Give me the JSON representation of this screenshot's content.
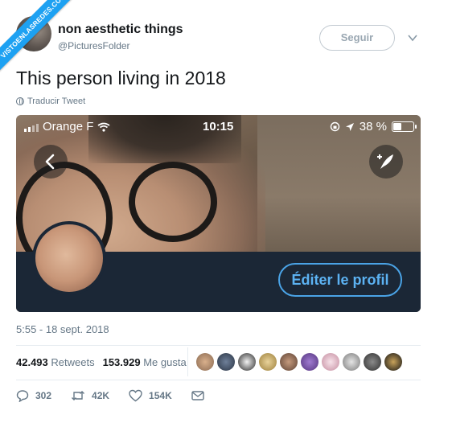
{
  "watermark": {
    "text": "VISTOENLASREDES.COM"
  },
  "author": {
    "display_name": "non aesthetic things",
    "handle": "@PicturesFolder"
  },
  "follow_button": {
    "label": "Seguir"
  },
  "tweet": {
    "text": "This person living in 2018",
    "translate_label": "Traducir Tweet",
    "timestamp": "5:55 - 18 sept. 2018"
  },
  "media": {
    "status_bar": {
      "carrier": "Orange F",
      "time": "10:15",
      "battery": "38 %",
      "battery_level": 0.38
    },
    "edit_profile_label": "Éditer le profil"
  },
  "stats": {
    "retweets_count": "42.493",
    "retweets_label": "Retweets",
    "likes_count": "153.929",
    "likes_label": "Me gusta"
  },
  "actions": {
    "replies": "302",
    "retweets": "42K",
    "likes": "154K"
  },
  "colors": {
    "accent": "#1da1f2",
    "profile_bar": "#1b2736",
    "edit_button": "#4aa3e6",
    "muted_text": "#657786"
  }
}
